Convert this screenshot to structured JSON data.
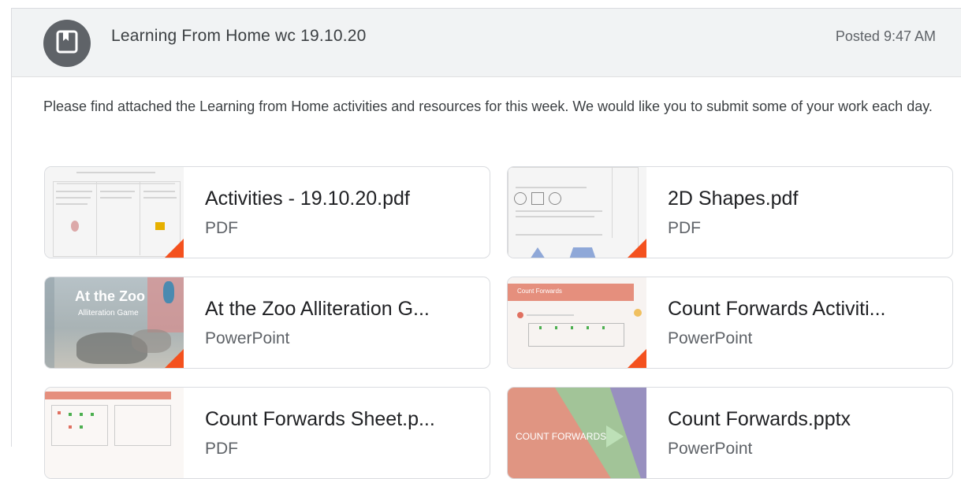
{
  "header": {
    "title": "Learning From Home wc 19.10.20",
    "posted": "Posted 9:47 AM"
  },
  "description": "Please find attached the Learning from Home activities and resources for this week. We would like you to submit some of your work each day.",
  "attachments": [
    {
      "name": "Activities - 19.10.20.pdf",
      "type": "PDF"
    },
    {
      "name": "2D Shapes.pdf",
      "type": "PDF"
    },
    {
      "name": "At the Zoo Alliteration G...",
      "type": "PowerPoint",
      "thumb_title": "At the Zoo",
      "thumb_subtitle": "Alliteration Game"
    },
    {
      "name": "Count Forwards Activiti...",
      "type": "PowerPoint",
      "thumb_title": "Count Forwards"
    },
    {
      "name": "Count Forwards Sheet.p...",
      "type": "PDF"
    },
    {
      "name": "Count Forwards.pptx",
      "type": "PowerPoint",
      "thumb_title": "COUNT FORWARDS"
    }
  ],
  "colors": {
    "header_bg": "#f1f3f4",
    "avatar_bg": "#5f6368",
    "file_corner": "#f4511e"
  },
  "icons": {
    "avatar": "assignment-bookmark-icon"
  }
}
